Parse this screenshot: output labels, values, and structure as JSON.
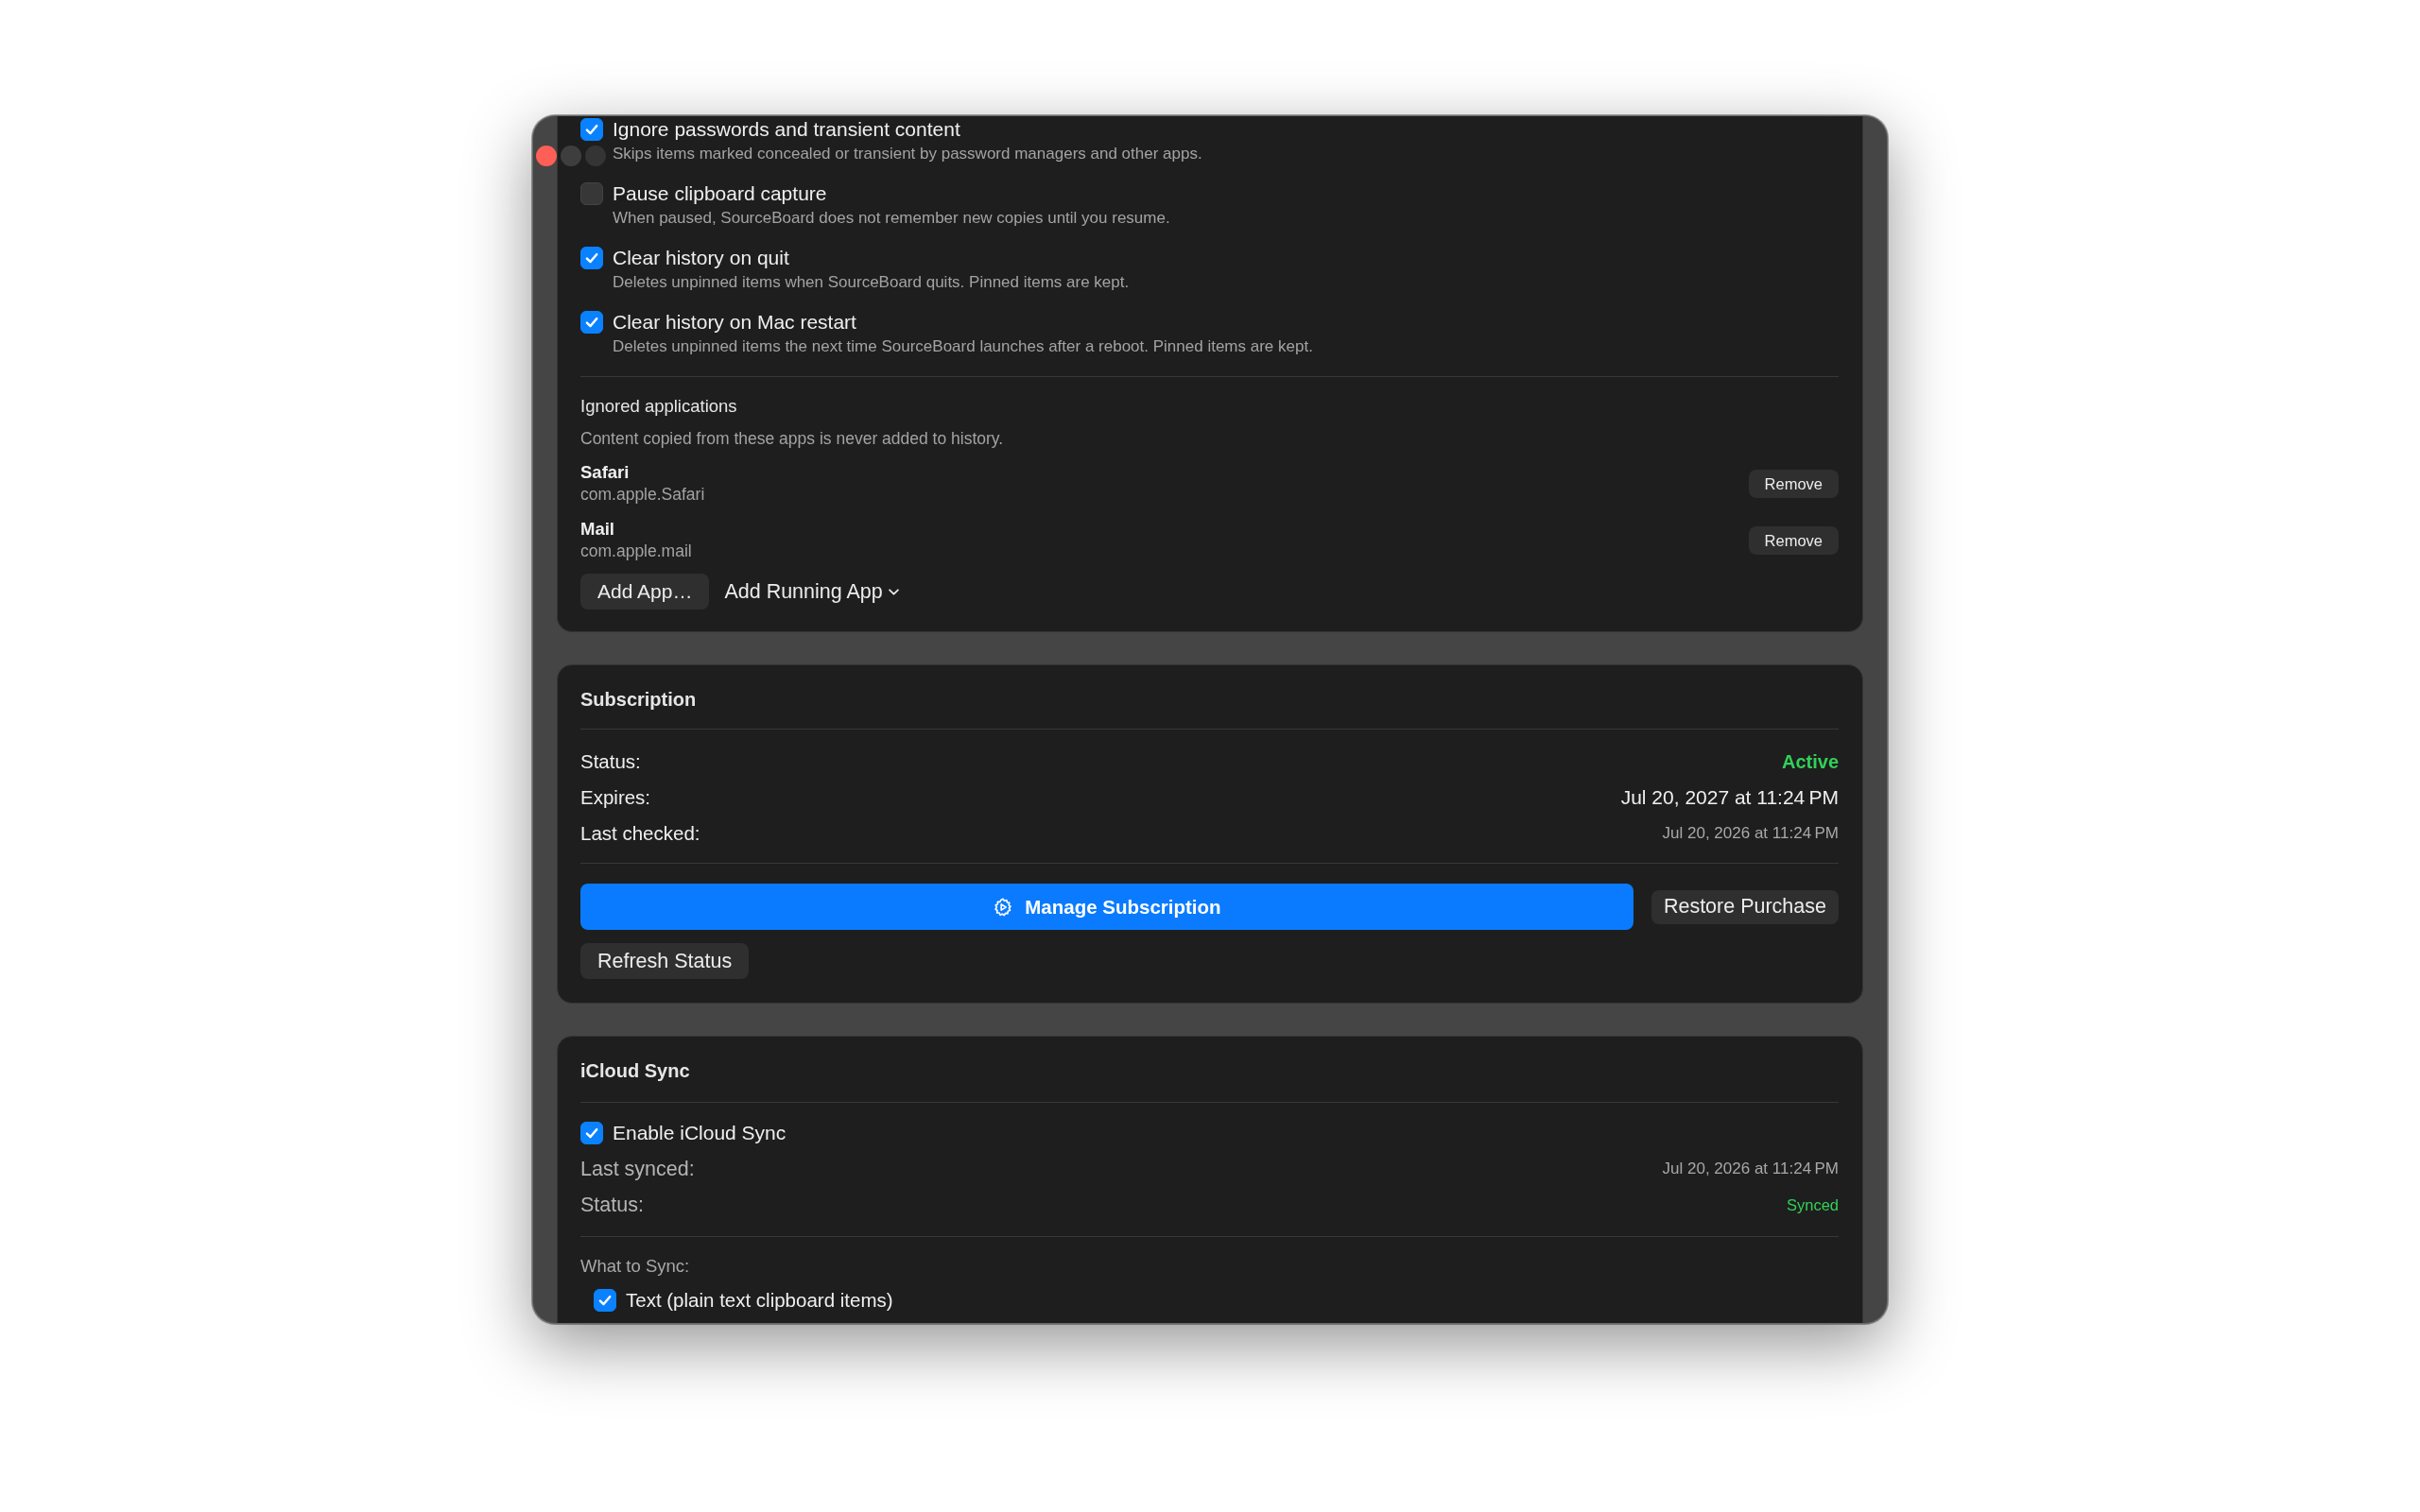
{
  "history_options": [
    {
      "label": "Ignore passwords and transient content",
      "description": "Skips items marked concealed or transient by password managers and other apps.",
      "checked": true
    },
    {
      "label": "Pause clipboard capture",
      "description": "When paused, SourceBoard does not remember new copies until you resume.",
      "checked": false
    },
    {
      "label": "Clear history on quit",
      "description": "Deletes unpinned items when SourceBoard quits. Pinned items are kept.",
      "checked": true
    },
    {
      "label": "Clear history on Mac restart",
      "description": "Deletes unpinned items the next time SourceBoard launches after a reboot. Pinned items are kept.",
      "checked": true
    }
  ],
  "ignored_applications": {
    "title": "Ignored applications",
    "description": "Content copied from these apps is never added to history.",
    "apps": [
      {
        "name": "Safari",
        "bundle_id": "com.apple.Safari",
        "remove_button": "Remove"
      },
      {
        "name": "Mail",
        "bundle_id": "com.apple.mail",
        "remove_button": "Remove"
      }
    ],
    "add_button": "Add App…",
    "add_running_menu": "Add Running App"
  },
  "subscription": {
    "title": "Subscription",
    "rows": [
      {
        "label": "Status:",
        "value": "Active",
        "kind": "status"
      },
      {
        "label": "Expires:",
        "value": "Jul 20, 2027 at 11:24 PM",
        "kind": "date"
      },
      {
        "label": "Last checked:",
        "value": "Jul 20, 2026 at 11:24 PM",
        "kind": "timestamp"
      }
    ],
    "manage_button": "Manage Subscription",
    "restore_button": "Restore Purchase",
    "refresh_button": "Refresh Status"
  },
  "icloud_sync": {
    "title": "iCloud Sync",
    "enable": {
      "label": "Enable iCloud Sync",
      "checked": true
    },
    "rows": [
      {
        "label": "Last synced:",
        "value": "Jul 20, 2026 at 11:24 PM",
        "kind": "timestamp"
      },
      {
        "label": "Status:",
        "value": "Synced",
        "kind": "status"
      }
    ],
    "what_to_sync": {
      "title": "What to Sync:",
      "items": [
        {
          "label": "Text (plain text clipboard items)",
          "checked": true
        }
      ]
    }
  }
}
